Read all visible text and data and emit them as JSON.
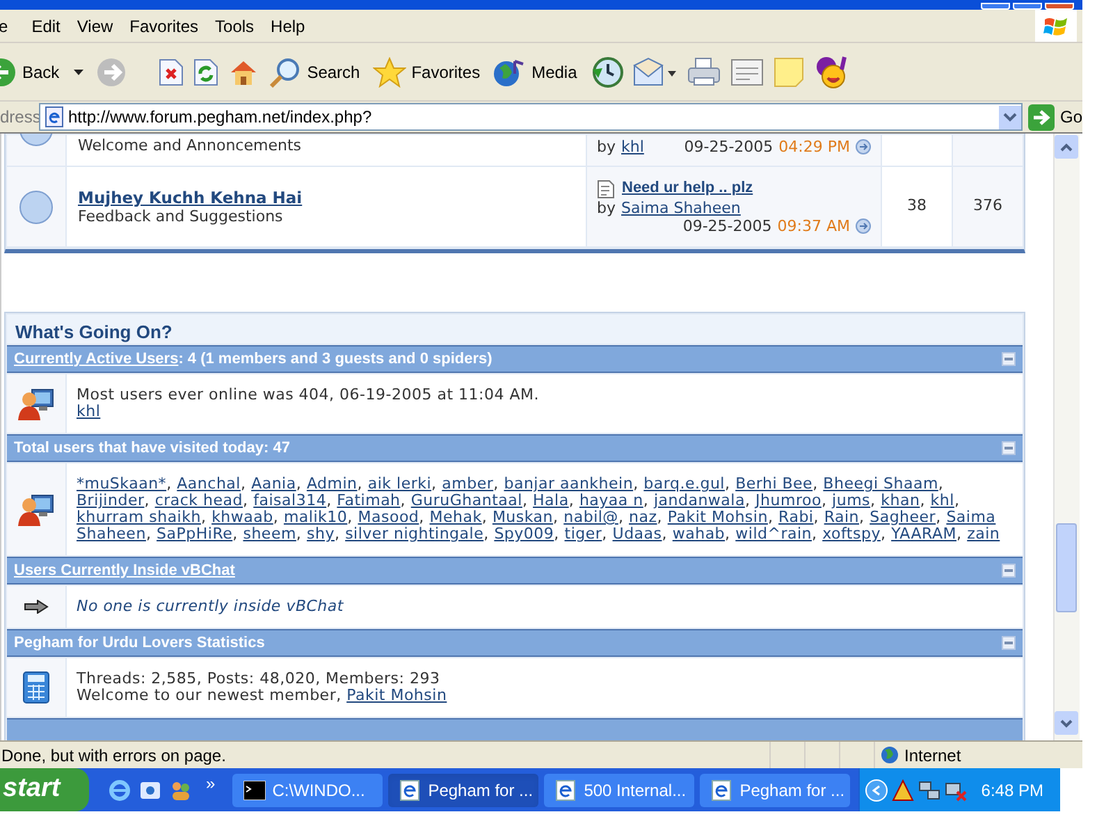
{
  "menu": [
    "e",
    "Edit",
    "View",
    "Favorites",
    "Tools",
    "Help"
  ],
  "toolbar": [
    {
      "kind": "back",
      "label": "Back"
    },
    {
      "kind": "forward"
    },
    {
      "kind": "stop"
    },
    {
      "kind": "refresh"
    },
    {
      "kind": "home"
    },
    {
      "kind": "search",
      "label": "Search"
    },
    {
      "kind": "favorites",
      "label": "Favorites"
    },
    {
      "kind": "media",
      "label": "Media"
    },
    {
      "kind": "history"
    },
    {
      "kind": "mail"
    },
    {
      "kind": "print"
    },
    {
      "kind": "edit"
    },
    {
      "kind": "note"
    },
    {
      "kind": "messenger"
    }
  ],
  "address": {
    "label": "dress",
    "value": "http://www.forum.pegham.net/index.php?",
    "go": "Go"
  },
  "forums": [
    {
      "description": "Welcome and Annoncements",
      "last_post": {
        "by": "by",
        "user": "khl",
        "date": "09-25-2005",
        "time": "04:29 PM"
      }
    },
    {
      "title": "Mujhey Kuchh Kehna Hai",
      "description": "Feedback and Suggestions",
      "last_post": {
        "thread": "Need ur help .. plz",
        "by": "by",
        "user": "Saima Shaheen",
        "date": "09-25-2005",
        "time": "09:37 AM"
      },
      "threads": "38",
      "posts": "376"
    }
  ],
  "whats_going_on": {
    "title": "What's Going On?",
    "sections": [
      {
        "kind": "users",
        "header": [
          {
            "kind": "link",
            "text": "Currently Active Users"
          },
          {
            "kind": "text",
            "text": ": 4 (1 members and 3 guests and 0 spiders)"
          }
        ],
        "lines": [
          [
            {
              "kind": "text",
              "text": "Most users ever online was 404, 06-19-2005 at 11:04 AM."
            }
          ],
          [
            {
              "kind": "link",
              "text": "khl"
            }
          ]
        ]
      },
      {
        "kind": "users",
        "header": [
          {
            "kind": "text",
            "text": "Total users that have visited today: 47"
          }
        ],
        "lines": [
          [
            {
              "kind": "link",
              "text": "*muSkaan*",
              "sep": ","
            },
            {
              "kind": "link",
              "text": "Aanchal",
              "sep": ","
            },
            {
              "kind": "link",
              "text": "Aania",
              "sep": ","
            },
            {
              "kind": "link",
              "text": "Admin",
              "sep": ","
            },
            {
              "kind": "link",
              "text": "aik lerki",
              "sep": ","
            },
            {
              "kind": "link",
              "text": "amber",
              "sep": ","
            },
            {
              "kind": "link",
              "text": "banjar aankhein",
              "sep": ","
            },
            {
              "kind": "link",
              "text": "barq.e.gul",
              "sep": ","
            },
            {
              "kind": "link",
              "text": "Berhi Bee",
              "sep": ","
            },
            {
              "kind": "link",
              "text": "Bheegi Shaam",
              "sep": ","
            }
          ],
          [
            {
              "kind": "link",
              "text": "Brijinder",
              "sep": ","
            },
            {
              "kind": "link",
              "text": "crack head",
              "sep": ","
            },
            {
              "kind": "link",
              "text": "faisal314",
              "sep": ","
            },
            {
              "kind": "link",
              "text": "Fatimah",
              "sep": ","
            },
            {
              "kind": "link",
              "text": "GuruGhantaal",
              "sep": ","
            },
            {
              "kind": "link",
              "text": "Hala",
              "sep": ","
            },
            {
              "kind": "link",
              "text": "hayaa n",
              "sep": ","
            },
            {
              "kind": "link",
              "text": "jandanwala",
              "sep": ","
            },
            {
              "kind": "link",
              "text": "Jhumroo",
              "sep": ","
            },
            {
              "kind": "link",
              "text": "jums",
              "sep": ","
            },
            {
              "kind": "link",
              "text": "khan",
              "sep": ","
            },
            {
              "kind": "link",
              "text": "khl",
              "sep": ","
            }
          ],
          [
            {
              "kind": "link",
              "text": "khurram shaikh",
              "sep": ","
            },
            {
              "kind": "link",
              "text": "khwaab",
              "sep": ","
            },
            {
              "kind": "link",
              "text": "malik10",
              "sep": ","
            },
            {
              "kind": "link",
              "text": "Masood",
              "sep": ","
            },
            {
              "kind": "link",
              "text": "Mehak",
              "sep": ","
            },
            {
              "kind": "link",
              "text": "Muskan",
              "sep": ","
            },
            {
              "kind": "link",
              "text": "nabil@",
              "sep": ","
            },
            {
              "kind": "link",
              "text": "naz",
              "sep": ","
            },
            {
              "kind": "link",
              "text": "Pakit Mohsin",
              "sep": ","
            },
            {
              "kind": "link",
              "text": "Rabi",
              "sep": ","
            },
            {
              "kind": "link",
              "text": "Rain",
              "sep": ","
            },
            {
              "kind": "link",
              "text": "Sagheer",
              "sep": ","
            },
            {
              "kind": "link",
              "text": "Saima"
            }
          ],
          [
            {
              "kind": "link",
              "text": "Shaheen",
              "sep": ","
            },
            {
              "kind": "link",
              "text": "SaPpHiRe",
              "sep": ","
            },
            {
              "kind": "link",
              "text": "sheem",
              "sep": ","
            },
            {
              "kind": "link",
              "text": "shy",
              "sep": ","
            },
            {
              "kind": "link",
              "text": "silver nightingale",
              "sep": ","
            },
            {
              "kind": "link",
              "text": "Spy009",
              "sep": ","
            },
            {
              "kind": "link",
              "text": "tiger",
              "sep": ","
            },
            {
              "kind": "link",
              "text": "Udaas",
              "sep": ","
            },
            {
              "kind": "link",
              "text": "wahab",
              "sep": ","
            },
            {
              "kind": "link",
              "text": "wild^rain",
              "sep": ","
            },
            {
              "kind": "link",
              "text": "xoftspy",
              "sep": ","
            },
            {
              "kind": "link",
              "text": "YAARAM",
              "sep": ","
            },
            {
              "kind": "link",
              "text": "zain"
            }
          ]
        ]
      },
      {
        "kind": "chat",
        "header": [
          {
            "kind": "link",
            "text": "Users Currently Inside vBChat"
          }
        ],
        "lines": [
          [
            {
              "kind": "text",
              "text": "No one is currently inside vBChat"
            }
          ]
        ]
      },
      {
        "kind": "stats",
        "header": [
          {
            "kind": "text",
            "text": "Pegham for Urdu Lovers Statistics"
          }
        ],
        "lines": [
          [
            {
              "kind": "text",
              "text": "Threads: 2,585, Posts: 48,020, Members: 293"
            }
          ],
          [
            {
              "kind": "text",
              "text": "Welcome to our newest member, "
            },
            {
              "kind": "link",
              "text": "Pakit Mohsin"
            }
          ]
        ]
      }
    ]
  },
  "status": {
    "text": "Done, but with errors on page.",
    "zone": "Internet"
  },
  "taskbar": {
    "start": "start",
    "more": "»",
    "tasks": [
      {
        "kind": "console",
        "label": "C:\\WINDO...",
        "selected": false
      },
      {
        "kind": "ie",
        "label": "Pegham for ...",
        "selected": true
      },
      {
        "kind": "ie",
        "label": "500 Internal...",
        "selected": false
      },
      {
        "kind": "ie",
        "label": "Pegham for ...",
        "selected": false
      }
    ],
    "clock": "6:48 PM"
  }
}
